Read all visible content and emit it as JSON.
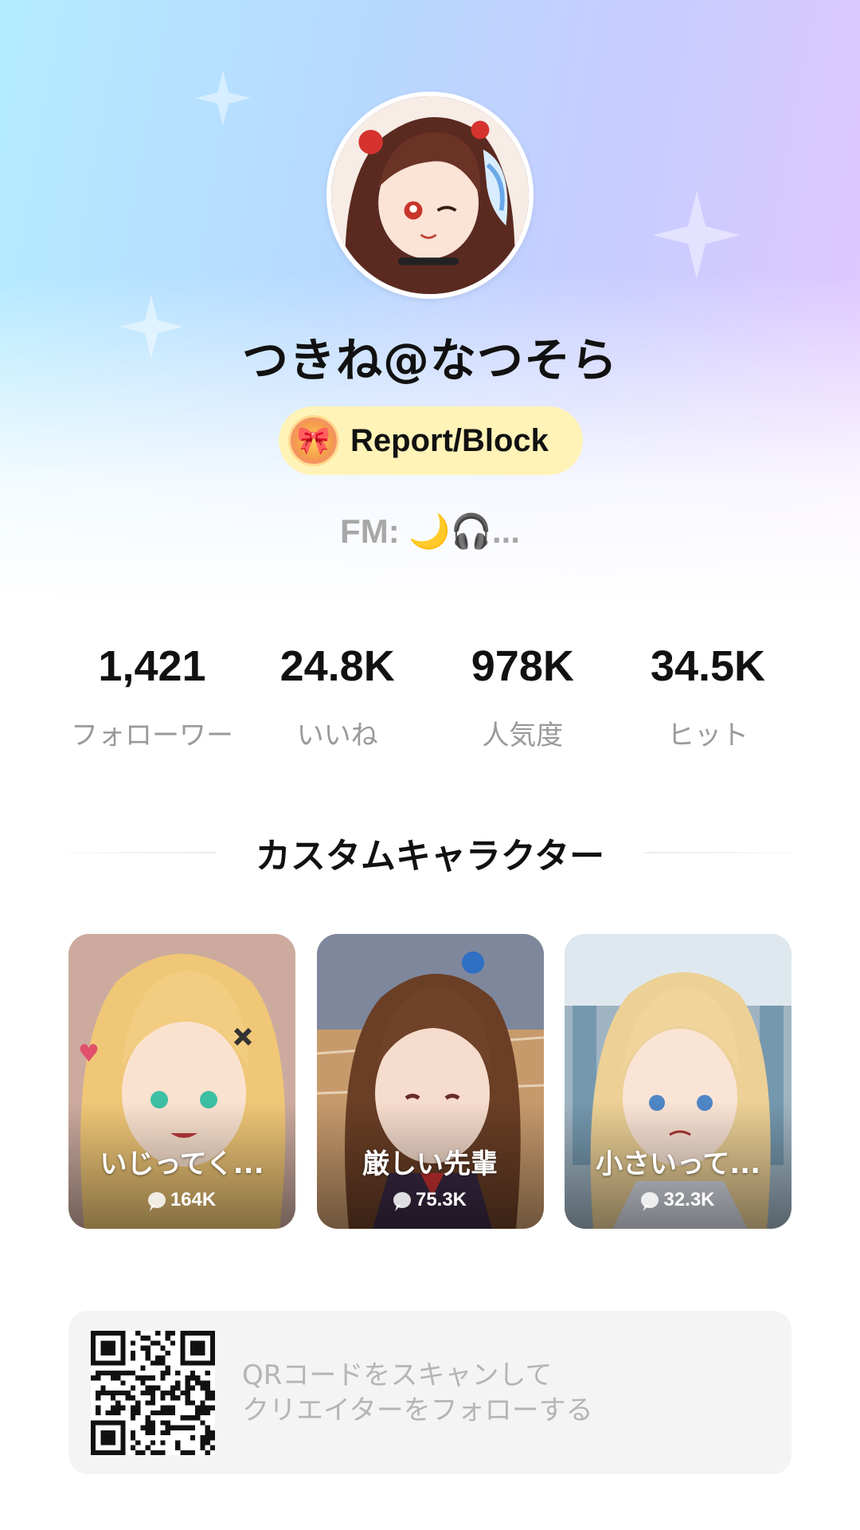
{
  "profile": {
    "username": "つきね@なつそら",
    "report_label": "Report/Block",
    "fm_text": "FM: 🌙🎧..."
  },
  "stats": [
    {
      "value": "1,421",
      "label": "フォローワー"
    },
    {
      "value": "24.8K",
      "label": "いいね"
    },
    {
      "value": "978K",
      "label": "人気度"
    },
    {
      "value": "34.5K",
      "label": "ヒット"
    }
  ],
  "section": {
    "title": "カスタムキャラクター"
  },
  "characters": [
    {
      "title": "いじってく...",
      "count": "164K"
    },
    {
      "title": "厳しい先輩",
      "count": "75.3K"
    },
    {
      "title": "小さいって...",
      "count": "32.3K"
    }
  ],
  "qr": {
    "line1": "QRコードをスキャンして",
    "line2": "クリエイターをフォローする"
  },
  "colors": {
    "accent_button_bg": "#fff3b8",
    "gradient_left": "#b3ecff",
    "gradient_right": "#e2c7ff",
    "muted_text": "#9a9a9a"
  }
}
